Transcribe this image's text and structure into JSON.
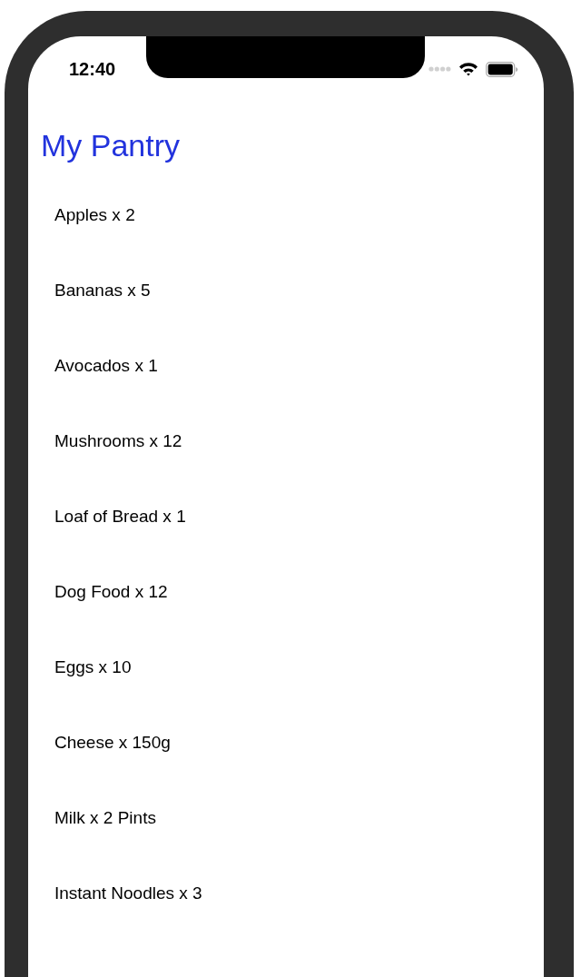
{
  "status_bar": {
    "time": "12:40"
  },
  "title": "My Pantry",
  "items": [
    {
      "label": "Apples x 2"
    },
    {
      "label": "Bananas x 5"
    },
    {
      "label": "Avocados x 1"
    },
    {
      "label": "Mushrooms x 12"
    },
    {
      "label": "Loaf of Bread x 1"
    },
    {
      "label": "Dog Food x 12"
    },
    {
      "label": "Eggs x 10"
    },
    {
      "label": "Cheese x 150g"
    },
    {
      "label": "Milk x 2 Pints"
    },
    {
      "label": "Instant Noodles x 3"
    }
  ]
}
